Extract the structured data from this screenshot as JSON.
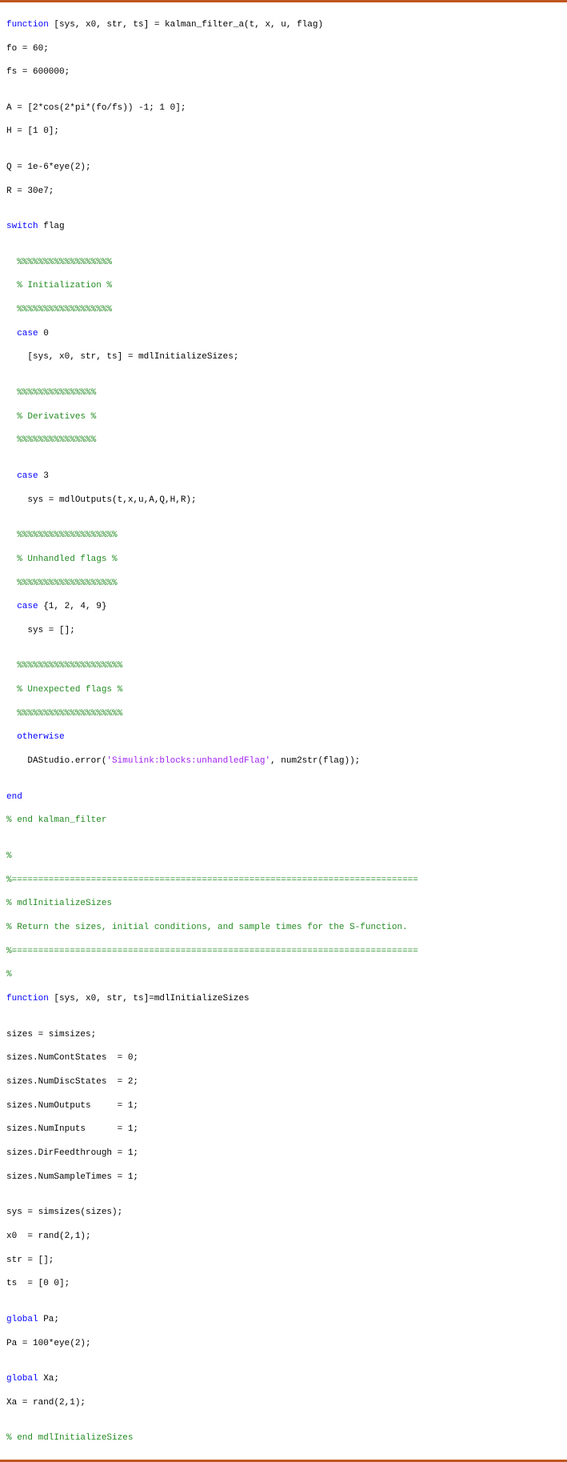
{
  "code": {
    "l1a": "function",
    "l1b": " [sys, x0, str, ts] = kalman_filter_a(t, x, u, flag)",
    "l2": "fo = 60;",
    "l3": "fs = 600000;",
    "l4": "",
    "l5": "A = [2*cos(2*pi*(fo/fs)) -1; 1 0];",
    "l6": "H = [1 0];",
    "l7": "",
    "l8": "Q = 1e-6*eye(2);",
    "l9": "R = 30e7;",
    "l10": "",
    "l11a": "switch",
    "l11b": " flag",
    "l12": "",
    "l13": "  %%%%%%%%%%%%%%%%%%",
    "l14": "  % Initialization %",
    "l15": "  %%%%%%%%%%%%%%%%%%",
    "l16a": "  ",
    "l16b": "case",
    "l16c": " 0",
    "l17": "    [sys, x0, str, ts] = mdlInitializeSizes;",
    "l18": "",
    "l19": "  %%%%%%%%%%%%%%%",
    "l20": "  % Derivatives %",
    "l21": "  %%%%%%%%%%%%%%%",
    "l22": "",
    "l23a": "  ",
    "l23b": "case",
    "l23c": " 3",
    "l24": "    sys = mdlOutputs(t,x,u,A,Q,H,R);",
    "l25": "",
    "l26": "  %%%%%%%%%%%%%%%%%%%",
    "l27": "  % Unhandled flags %",
    "l28": "  %%%%%%%%%%%%%%%%%%%",
    "l29a": "  ",
    "l29b": "case",
    "l29c": " {1, 2, 4, 9}",
    "l30": "    sys = [];",
    "l31": "",
    "l32": "  %%%%%%%%%%%%%%%%%%%%",
    "l33": "  % Unexpected flags %",
    "l34": "  %%%%%%%%%%%%%%%%%%%%",
    "l35a": "  ",
    "l35b": "otherwise",
    "l36a": "    DAStudio.error(",
    "l36b": "'Simulink:blocks:unhandledFlag'",
    "l36c": ", num2str(flag));",
    "l37": "",
    "l38": "end",
    "l39": "% end kalman_filter",
    "l40": "",
    "l41": "%",
    "l42": "%=============================================================================",
    "l43": "% mdlInitializeSizes",
    "l44": "% Return the sizes, initial conditions, and sample times for the S-function.",
    "l45": "%=============================================================================",
    "l46": "%",
    "l47a": "function",
    "l47b": " [sys, x0, str, ts]=mdlInitializeSizes",
    "l48": "",
    "l49": "sizes = simsizes;",
    "l50": "sizes.NumContStates  = 0;",
    "l51": "sizes.NumDiscStates  = 2;",
    "l52": "sizes.NumOutputs     = 1;",
    "l53": "sizes.NumInputs      = 1;",
    "l54": "sizes.DirFeedthrough = 1;",
    "l55": "sizes.NumSampleTimes = 1;",
    "l56": "",
    "l57": "sys = simsizes(sizes);",
    "l58": "x0  = rand(2,1);",
    "l59": "str = [];",
    "l60": "ts  = [0 0];",
    "l61": "",
    "l62a": "global",
    "l62b": " Pa;",
    "l63": "Pa = 100*eye(2);",
    "l64": "",
    "l65a": "global",
    "l65b": " Xa;",
    "l66": "Xa = rand(2,1);",
    "l67": "",
    "l68": "% end mdlInitializeSizes"
  }
}
